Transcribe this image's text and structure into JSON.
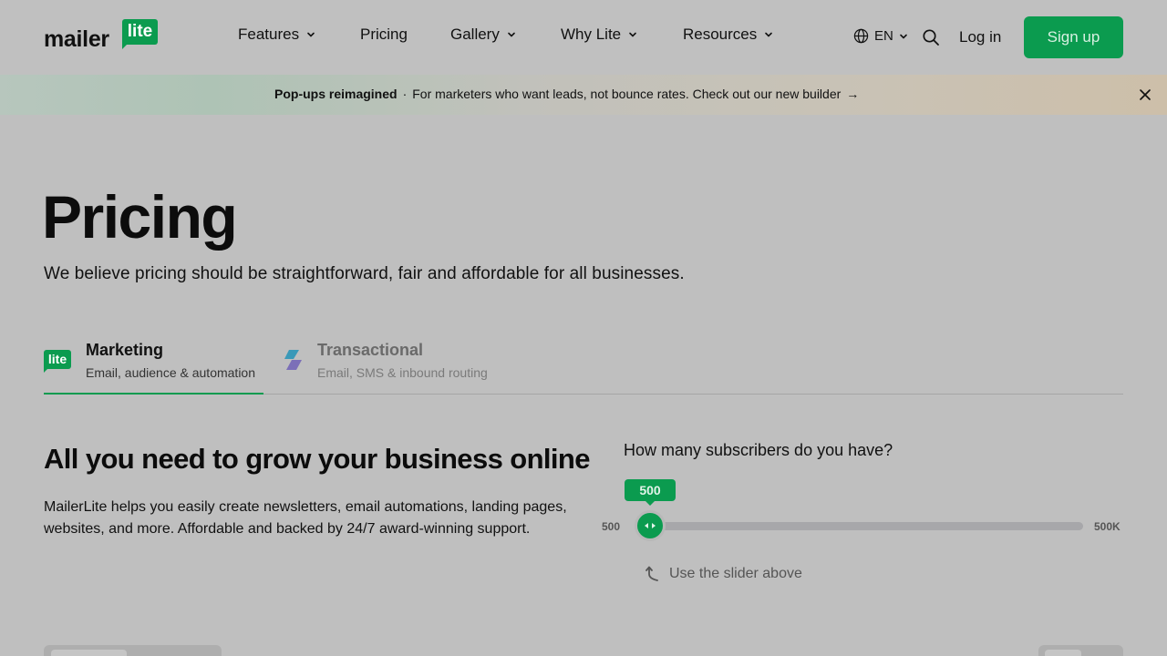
{
  "header": {
    "logo": {
      "word": "mailer",
      "badge": "lite"
    },
    "nav": [
      {
        "label": "Features",
        "dropdown": true
      },
      {
        "label": "Pricing",
        "dropdown": false
      },
      {
        "label": "Gallery",
        "dropdown": true
      },
      {
        "label": "Why Lite",
        "dropdown": true
      },
      {
        "label": "Resources",
        "dropdown": true
      }
    ],
    "language": "EN",
    "login_label": "Log in",
    "signup_label": "Sign up"
  },
  "banner": {
    "bold": "Pop-ups reimagined",
    "separator": "·",
    "text": "For marketers who want leads, not bounce rates. Check out our new builder",
    "arrow": "→"
  },
  "hero": {
    "title": "Pricing",
    "subtitle": "We believe pricing should be straightforward, fair and affordable for all businesses."
  },
  "tabs": [
    {
      "title": "Marketing",
      "subtitle": "Email, audience & automation",
      "icon": "lite",
      "active": true
    },
    {
      "title": "Transactional",
      "subtitle": "Email, SMS & inbound routing",
      "active": false
    }
  ],
  "plan_intro": {
    "headline": "All you need to grow your business online",
    "description": "MailerLite helps you easily create newsletters, email automations, landing pages, websites, and more. Affordable and backed by 24/7 award-winning support."
  },
  "subscriber_slider": {
    "question": "How many subscribers do you have?",
    "current_value": "500",
    "min_label": "500",
    "max_label": "500K",
    "hint": "Use the slider above"
  },
  "colors": {
    "brand_green": "#0b9b4f",
    "background": "#bfbfbf"
  },
  "icons": [
    "chevron-down-icon",
    "globe-icon",
    "search-icon",
    "close-icon",
    "arrow-right-icon",
    "transactional-bolt-icon",
    "slider-arrows-icon",
    "curved-arrow-up-icon"
  ]
}
